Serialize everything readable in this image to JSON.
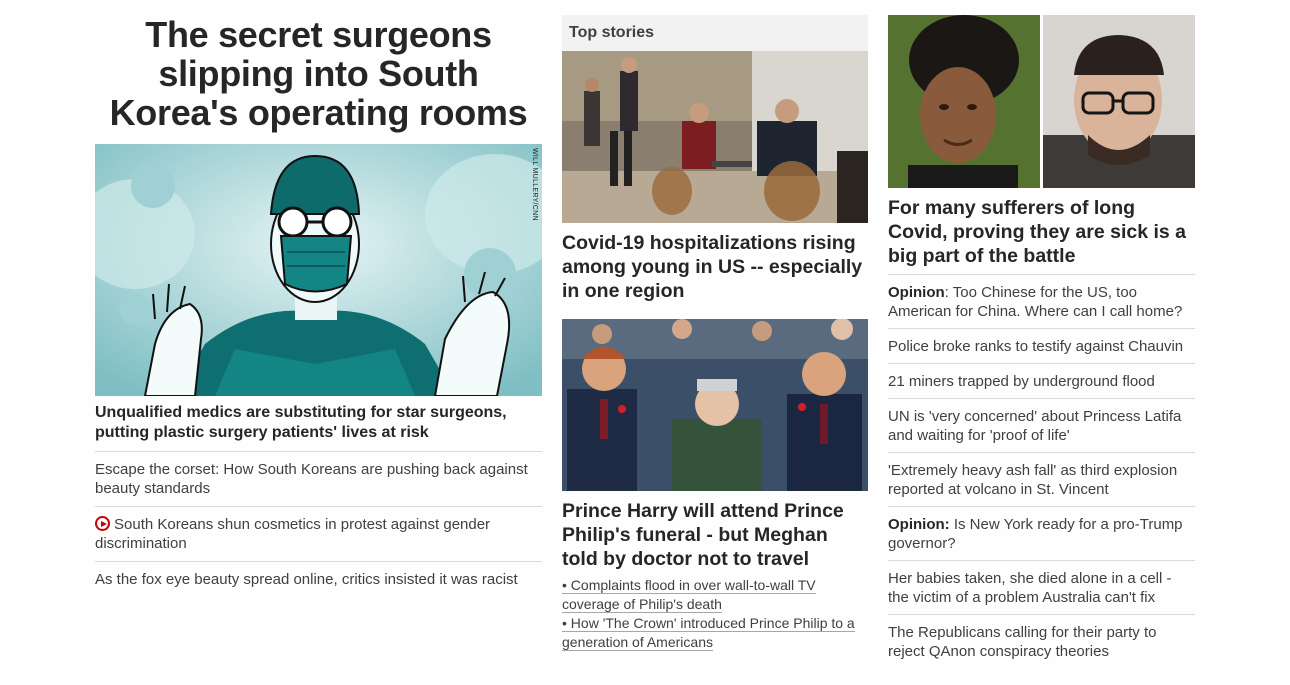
{
  "left": {
    "headline": "The secret surgeons slipping into South Korea's operating rooms",
    "image_credit": "WILL MULLERY/CNN",
    "lead_sub": "Unqualified medics are substituting for star surgeons, putting plastic surgery patients' lives at risk",
    "links": [
      {
        "text": "Escape the corset: How South Koreans are pushing back against beauty standards",
        "video": false
      },
      {
        "text": "South Koreans shun cosmetics in protest against gender discrimination",
        "video": true
      },
      {
        "text": "As the fox eye beauty spread online, critics insisted it was racist",
        "video": false
      }
    ]
  },
  "middle": {
    "section_label": "Top stories",
    "story1_headline": "Covid-19 hospitalizations rising among young in US -- especially in one region",
    "story2_headline": "Prince Harry will attend Prince Philip's funeral - but Meghan told by doctor not to travel",
    "story2_bullets": [
      "Complaints flood in over wall-to-wall TV coverage of Philip's death",
      "How 'The Crown' introduced Prince Philip to a generation of Americans"
    ]
  },
  "right": {
    "headline": "For many sufferers of long Covid, proving they are sick is a big part of the battle",
    "items": [
      {
        "prefix": "Opinion",
        "sep": ": ",
        "text": "Too Chinese for the US, too American for China. Where can I call home?"
      },
      {
        "prefix": "",
        "sep": "",
        "text": "Police broke ranks to testify against Chauvin"
      },
      {
        "prefix": "",
        "sep": "",
        "text": "21 miners trapped by underground flood"
      },
      {
        "prefix": "",
        "sep": "",
        "text": "UN is 'very concerned' about Princess Latifa and waiting for 'proof of life'"
      },
      {
        "prefix": "",
        "sep": "",
        "text": "'Extremely heavy ash fall' as third explosion reported at volcano in St. Vincent"
      },
      {
        "prefix": "Opinion:",
        "sep": " ",
        "text": "Is New York ready for a pro-Trump governor?"
      },
      {
        "prefix": "",
        "sep": "",
        "text": "Her babies taken, she died alone in a cell - the victim of a problem Australia can't fix"
      },
      {
        "prefix": "",
        "sep": "",
        "text": "The Republicans calling for their party to reject QAnon conspiracy theories"
      }
    ]
  },
  "colors": {
    "text": "#262626",
    "muted_text": "#404040",
    "divider": "#d9d9d9",
    "video_icon": "#cc0000",
    "section_bg": "#f2f2f2"
  }
}
